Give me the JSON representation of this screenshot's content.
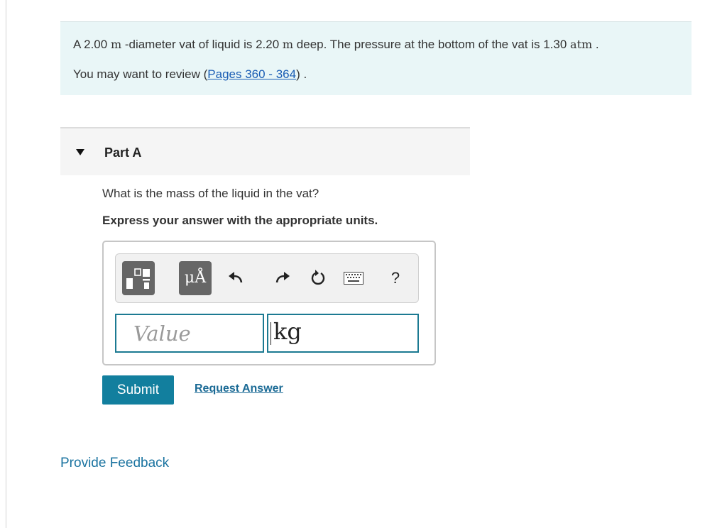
{
  "problem": {
    "text_a": "A 2.00 ",
    "diameter_unit": "m",
    "text_b": " -diameter vat of liquid is 2.20 ",
    "depth_unit": "m",
    "text_c": " deep. The pressure at the bottom of the vat is 1.30 ",
    "pressure_unit": "atm",
    "text_d": " .",
    "review_prefix": "You may want to review (",
    "review_link": "Pages 360 - 364",
    "review_suffix": ") ."
  },
  "part": {
    "title": "Part A",
    "question": "What is the mass of the liquid in the vat?",
    "instruction": "Express your answer with the appropriate units."
  },
  "toolbar": {
    "templates_icon": "templates-icon",
    "units_label": "μÅ",
    "icons": [
      "undo-icon",
      "redo-icon",
      "reset-icon",
      "keyboard-icon",
      "help-icon"
    ],
    "help_label": "?"
  },
  "answer": {
    "value": "",
    "value_placeholder": "Value",
    "units_value": "kg"
  },
  "actions": {
    "submit_label": "Submit",
    "request_answer_label": "Request Answer"
  },
  "footer": {
    "feedback_label": "Provide Feedback"
  },
  "colors": {
    "intro_bg": "#e9f6f7",
    "accent": "#127f9e",
    "link": "#1a5db4",
    "input_border": "#1c7a92"
  }
}
